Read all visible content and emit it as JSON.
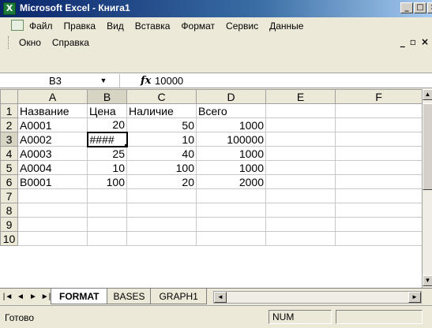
{
  "window": {
    "title": "Microsoft Excel - Книга1",
    "app_icon": "excel-icon"
  },
  "menu": {
    "row1": [
      "Файл",
      "Правка",
      "Вид",
      "Вставка",
      "Формат",
      "Сервис",
      "Данные"
    ],
    "row2": [
      "Окно",
      "Справка"
    ]
  },
  "formula_bar": {
    "cell_ref": "B3",
    "fx_label": "fx",
    "value": "10000"
  },
  "sheet": {
    "columns": [
      "A",
      "B",
      "C",
      "D",
      "E",
      "F"
    ],
    "rows": [
      {
        "n": "1",
        "cells": [
          "Название",
          "Цена",
          "Наличие",
          "Всего",
          "",
          ""
        ]
      },
      {
        "n": "2",
        "cells": [
          "A0001",
          "20",
          "50",
          "1000",
          "",
          ""
        ]
      },
      {
        "n": "3",
        "cells": [
          "A0002",
          "####",
          "10",
          "100000",
          "",
          ""
        ]
      },
      {
        "n": "4",
        "cells": [
          "A0003",
          "25",
          "40",
          "1000",
          "",
          ""
        ]
      },
      {
        "n": "5",
        "cells": [
          "A0004",
          "10",
          "100",
          "1000",
          "",
          ""
        ]
      },
      {
        "n": "6",
        "cells": [
          "B0001",
          "100",
          "20",
          "2000",
          "",
          ""
        ]
      },
      {
        "n": "7",
        "cells": [
          "",
          "",
          "",
          "",
          "",
          ""
        ]
      },
      {
        "n": "8",
        "cells": [
          "",
          "",
          "",
          "",
          "",
          ""
        ]
      },
      {
        "n": "9",
        "cells": [
          "",
          "",
          "",
          "",
          "",
          ""
        ]
      },
      {
        "n": "10",
        "cells": [
          "",
          "",
          "",
          "",
          "",
          ""
        ]
      }
    ],
    "active_cell": "B3"
  },
  "tabs": [
    "FORMAT",
    "BASES",
    "GRAPH1"
  ],
  "active_tab": "FORMAT",
  "status": {
    "ready": "Готово",
    "num": "NUM"
  }
}
